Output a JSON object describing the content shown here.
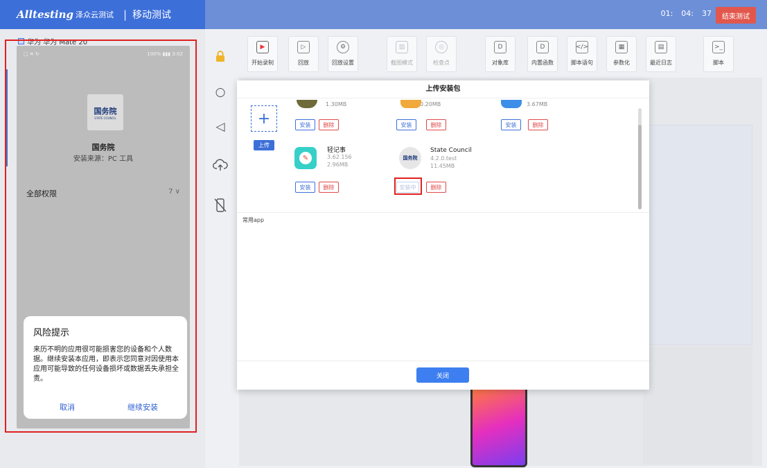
{
  "header": {
    "logo": "Alltesting",
    "logo_sub": "泽众云测试",
    "separator": "|",
    "module": "移动测试",
    "timer": {
      "h": "01:",
      "m": "04:",
      "s": "37"
    },
    "end_button": "结束测试"
  },
  "device": {
    "label": "华为 华为 Mate 20",
    "status_left": "□ ≋ ↻",
    "status_right": "100% ▮▮▮ 3:02",
    "app_logo_text": "国务院",
    "app_logo_sub": "STATE COUNCIL",
    "app_name": "国务院",
    "install_source": "安装来源：PC 工具",
    "permissions_label": "全部权限",
    "permissions_count": "7 ∨",
    "risk_dialog": {
      "title": "风险提示",
      "body": "来历不明的应用很可能损害您的设备和个人数据。继续安装本应用，即表示您同意对因使用本应用可能导致的任何设备损坏或数据丢失承担全责。",
      "cancel": "取消",
      "continue": "继续安装"
    }
  },
  "side_icons": [
    "lock-icon",
    "home-circle-icon",
    "back-triangle-icon",
    "cloud-upload-icon",
    "phone-off-icon"
  ],
  "side_glyphs": {
    "lock": "🔒",
    "home": "○",
    "back": "◁",
    "cloud": "☁",
    "phone": "▯"
  },
  "toolbar": {
    "record": "开始录制",
    "playback": "回放",
    "playback_settings": "回放设置",
    "screenshot_mode": "截图模式",
    "checkpoint": "检查点",
    "object_lib": "对象库",
    "builtin_func": "内置函数",
    "script_stmt": "脚本语句",
    "parameterize": "参数化",
    "recent_log": "最近日志",
    "script": "脚本"
  },
  "modal": {
    "title": "上传安装包",
    "upload_button": "上传",
    "upload_plus": "+",
    "top_sizes": [
      "1.30MB",
      "0.20MB",
      "3.67MB"
    ],
    "install_label": "安装",
    "delete_label": "删除",
    "installing_label": "安装中",
    "apps": [
      {
        "name": "轻记事",
        "version": "3.62.156",
        "size": "2.96MB",
        "icon_glyph": "✎"
      },
      {
        "name": "State Council",
        "version": "4.2.0.test",
        "size": "11.45MB",
        "icon_glyph": "国务院"
      }
    ],
    "common_apps_label": "常用app",
    "close_button": "关闭"
  }
}
